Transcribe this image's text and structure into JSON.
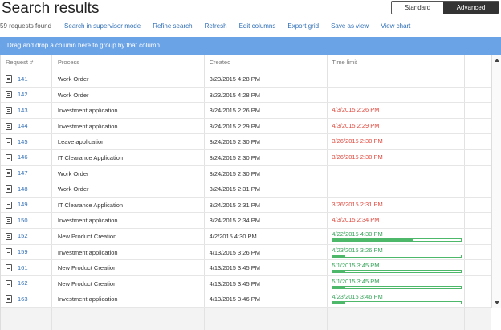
{
  "header": {
    "title": "Search results",
    "standard_view": "Standard View",
    "advanced_view": "Advanced View"
  },
  "toolbar": {
    "count": "59 requests found",
    "links": [
      "Search in supervisor mode",
      "Refine search",
      "Refresh",
      "Edit columns",
      "Export grid",
      "Save as view",
      "View chart"
    ]
  },
  "group_bar": "Drag and drop a column here to group by that column",
  "columns": [
    "Request #",
    "Process",
    "Created",
    "Time limit"
  ],
  "colors": {
    "accent": "#2f6fb7",
    "group_bar": "#6aa3e6",
    "overdue": "#e04a3f",
    "on_time": "#3aa55c"
  },
  "rows": [
    {
      "id": "141",
      "process": "Work Order",
      "created": "3/23/2015 4:28 PM",
      "limit": "",
      "status": "none",
      "progress": 0
    },
    {
      "id": "142",
      "process": "Work Order",
      "created": "3/23/2015 4:28 PM",
      "limit": "",
      "status": "none",
      "progress": 0
    },
    {
      "id": "143",
      "process": "Investment application",
      "created": "3/24/2015 2:26 PM",
      "limit": "4/3/2015 2:26 PM",
      "status": "overdue",
      "progress": 0
    },
    {
      "id": "144",
      "process": "Investment application",
      "created": "3/24/2015 2:29 PM",
      "limit": "4/3/2015 2:29 PM",
      "status": "overdue",
      "progress": 0
    },
    {
      "id": "145",
      "process": "Leave application",
      "created": "3/24/2015 2:30 PM",
      "limit": "3/26/2015 2:30 PM",
      "status": "overdue",
      "progress": 0
    },
    {
      "id": "146",
      "process": "IT Clearance Application",
      "created": "3/24/2015 2:30 PM",
      "limit": "3/26/2015 2:30 PM",
      "status": "overdue",
      "progress": 0
    },
    {
      "id": "147",
      "process": "Work Order",
      "created": "3/24/2015 2:30 PM",
      "limit": "",
      "status": "none",
      "progress": 0
    },
    {
      "id": "148",
      "process": "Work Order",
      "created": "3/24/2015 2:31 PM",
      "limit": "",
      "status": "none",
      "progress": 0
    },
    {
      "id": "149",
      "process": "IT Clearance Application",
      "created": "3/24/2015 2:31 PM",
      "limit": "3/26/2015 2:31 PM",
      "status": "overdue",
      "progress": 0
    },
    {
      "id": "150",
      "process": "Investment application",
      "created": "3/24/2015 2:34 PM",
      "limit": "4/3/2015 2:34 PM",
      "status": "overdue",
      "progress": 0
    },
    {
      "id": "152",
      "process": "New Product Creation",
      "created": "4/2/2015 4:30 PM",
      "limit": "4/22/2015 4:30 PM",
      "status": "on_time",
      "progress": 0.63
    },
    {
      "id": "159",
      "process": "Investment application",
      "created": "4/13/2015 3:26 PM",
      "limit": "4/23/2015 3:26 PM",
      "status": "on_time",
      "progress": 0.1
    },
    {
      "id": "161",
      "process": "New Product Creation",
      "created": "4/13/2015 3:45 PM",
      "limit": "5/1/2015 3:45 PM",
      "status": "on_time",
      "progress": 0.1
    },
    {
      "id": "162",
      "process": "New Product Creation",
      "created": "4/13/2015 3:45 PM",
      "limit": "5/1/2015 3:45 PM",
      "status": "on_time",
      "progress": 0.1
    },
    {
      "id": "163",
      "process": "Investment application",
      "created": "4/13/2015 3:46 PM",
      "limit": "4/23/2015 3:46 PM",
      "status": "on_time",
      "progress": 0.1
    }
  ]
}
